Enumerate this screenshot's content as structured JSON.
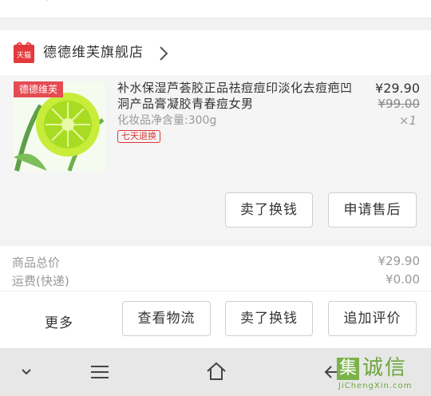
{
  "shop": {
    "name": "德德维芙旗舰店",
    "logo_text": "天猫"
  },
  "product": {
    "thumb_tag": "德德维芙",
    "title": "补水保湿芦荟胶正品祛痘痘印淡化去痘疤凹洞产品膏凝胶青春痘女男",
    "spec": "化妆品净含量:300g",
    "badge": "七天退换",
    "price": "¥29.90",
    "original_price": "¥99.00",
    "quantity": "×1",
    "buttons": {
      "sell": "卖了换钱",
      "after_sale": "申请售后"
    }
  },
  "summary": [
    {
      "label": "商品总价",
      "value": "¥29.90"
    },
    {
      "label": "运费(快递)",
      "value": "¥0.00"
    }
  ],
  "actions": {
    "more": "更多",
    "logistics": "查看物流",
    "sell": "卖了换钱",
    "review": "追加评价"
  },
  "navbar": {
    "icons": [
      "chevron-down-icon",
      "menu-icon",
      "home-icon",
      "back-icon"
    ]
  },
  "watermark": {
    "char": "集",
    "text": "诚信",
    "url": "JiChengXin.com"
  },
  "colors": {
    "tmall_red": "#e4393c",
    "badge_red": "#d33333",
    "watermark_green": "#6aa739"
  }
}
